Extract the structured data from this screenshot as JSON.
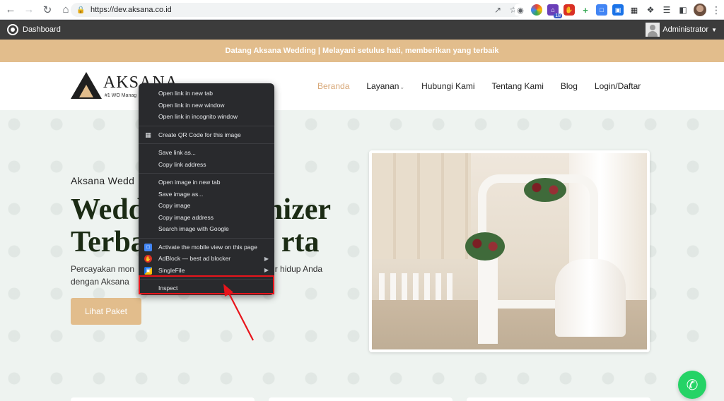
{
  "browser": {
    "url": "https://dev.aksana.co.id",
    "extension_badge": "18"
  },
  "adminbar": {
    "dashboard_label": "Dashboard",
    "user_label": "Administrator"
  },
  "announcement": "Datang Aksana Wedding | Melayani setulus hati, memberikan yang terbaik",
  "header": {
    "brand": "AKSANA",
    "tagline": "#1 WO Manag",
    "nav": [
      {
        "label": "Beranda",
        "active": true
      },
      {
        "label": "Layanan"
      },
      {
        "label": "Hubungi Kami"
      },
      {
        "label": "Tentang Kami"
      },
      {
        "label": "Blog"
      },
      {
        "label": "Login/Daftar"
      }
    ]
  },
  "hero": {
    "subtitle": "Aksana Wedd",
    "title_line1": "Wedd",
    "title_line1_end": "nizer",
    "title_line2": "Terba",
    "title_line2_end": "rta",
    "desc_line1": "Percayakan mon",
    "desc_line1_end": "ur hidup Anda",
    "desc_line2": "dengan Aksana",
    "button_label": "Lihat Paket"
  },
  "context_menu": {
    "groups": [
      [
        "Open link in new tab",
        "Open link in new window",
        "Open link in incognito window"
      ],
      [
        "Create QR Code for this image"
      ],
      [
        "Save link as...",
        "Copy link address"
      ],
      [
        "Open image in new tab",
        "Save image as...",
        "Copy image",
        "Copy image address",
        "Search image with Google"
      ],
      [
        "Activate the mobile view on this page",
        "AdBlock — best ad blocker",
        "SingleFile"
      ],
      [
        "Inspect"
      ]
    ]
  },
  "colors": {
    "accent": "#e2bd8c",
    "adminbar": "#3c3c3c",
    "menu_bg": "#292a2d",
    "highlight": "#e8141b",
    "whatsapp": "#25d366"
  }
}
